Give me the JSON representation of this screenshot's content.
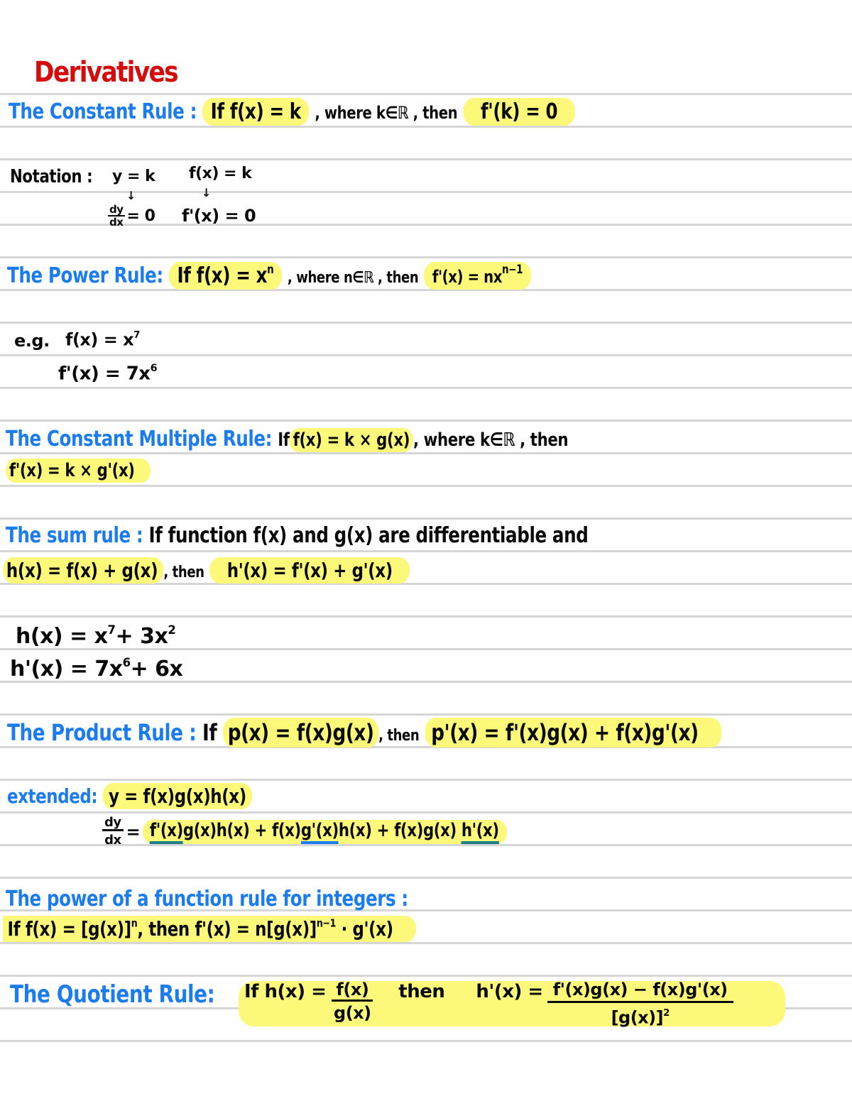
{
  "title": "Derivatives",
  "constant_rule": {
    "heading": "The Constant Rule :",
    "condition": "If f(x) = k",
    "middle": ", where k∈ℝ , then",
    "result": "f'(k) = 0"
  },
  "notation": {
    "label": "Notation :",
    "left_top": "y = k",
    "left_bottom_num": "dy",
    "left_bottom_den": "dx",
    "left_bottom_rest": "= 0",
    "right_top": "f(x) = k",
    "right_bottom": "f'(x) = 0",
    "arrow": "↓"
  },
  "power_rule": {
    "heading": "The Power Rule:",
    "condition_base": "If f(x) = x",
    "condition_exp": "n",
    "middle": ", where n∈ℝ , then",
    "result_base": "f'(x) = nx",
    "result_exp": "n−1"
  },
  "power_example": {
    "label": "e.g.",
    "line1_base": "f(x) = x",
    "line1_exp": "7",
    "line2_base": "f'(x) = 7x",
    "line2_exp": "6"
  },
  "constant_multiple_rule": {
    "heading": "The Constant Multiple Rule:",
    "prefix": "If",
    "condition": "f(x) = k × g(x)",
    "middle": ", where k∈ℝ , then",
    "result": "f'(x) = k × g'(x)"
  },
  "sum_rule": {
    "heading": "The sum rule :",
    "line1": "If function f(x) and g(x) are differentiable and",
    "condition": "h(x) = f(x) + g(x)",
    "middle": ", then",
    "result": "h'(x) = f'(x) + g'(x)"
  },
  "sum_example": {
    "line1_a": "h(x) = x",
    "line1_a_exp": "7",
    "line1_b": "+ 3x",
    "line1_b_exp": "2",
    "line2_a": "h'(x) = 7x",
    "line2_a_exp": "6",
    "line2_b": "+ 6x"
  },
  "product_rule": {
    "heading": "The Product Rule :",
    "prefix": "If",
    "condition": "p(x) = f(x)g(x)",
    "middle": ", then",
    "result": "p'(x) = f'(x)g(x) + f(x)g'(x)"
  },
  "extended": {
    "label": "extended:",
    "expression": "y = f(x)g(x)h(x)",
    "deriv_num": "dy",
    "deriv_den": "dx",
    "eq": "=",
    "term1_a": "f'(x)",
    "term1_b": "g(x)h(x) + f(x)",
    "term2_a": "g'(x)",
    "term2_b": "h(x) + f(x)g(x)",
    "term3_a": "h'(x)"
  },
  "power_function_rule": {
    "heading": "The power of a function rule for integers :",
    "condition": "If f(x) = [g(x)]",
    "condition_exp": "n",
    "middle": ", then f'(x) = n[g(x)]",
    "middle_exp": "n−1",
    "end": "· g'(x)"
  },
  "quotient_rule": {
    "heading": "The Quotient Rule:",
    "prefix": "If h(x) =",
    "frac_num": "f(x)",
    "frac_den": "g(x)",
    "then": "then",
    "result_prefix": "h'(x) =",
    "result_num": "f'(x)g(x) − f(x)g'(x)",
    "result_den_base": "[g(x)]",
    "result_den_exp": "2"
  },
  "colors": {
    "title": "#d40c0c",
    "heading": "#1b7cf0",
    "ink": "#0a0a0a",
    "highlight": "#fbf87a",
    "underline_teal": "#1a7f86",
    "rule_line": "#d6d6d8"
  }
}
